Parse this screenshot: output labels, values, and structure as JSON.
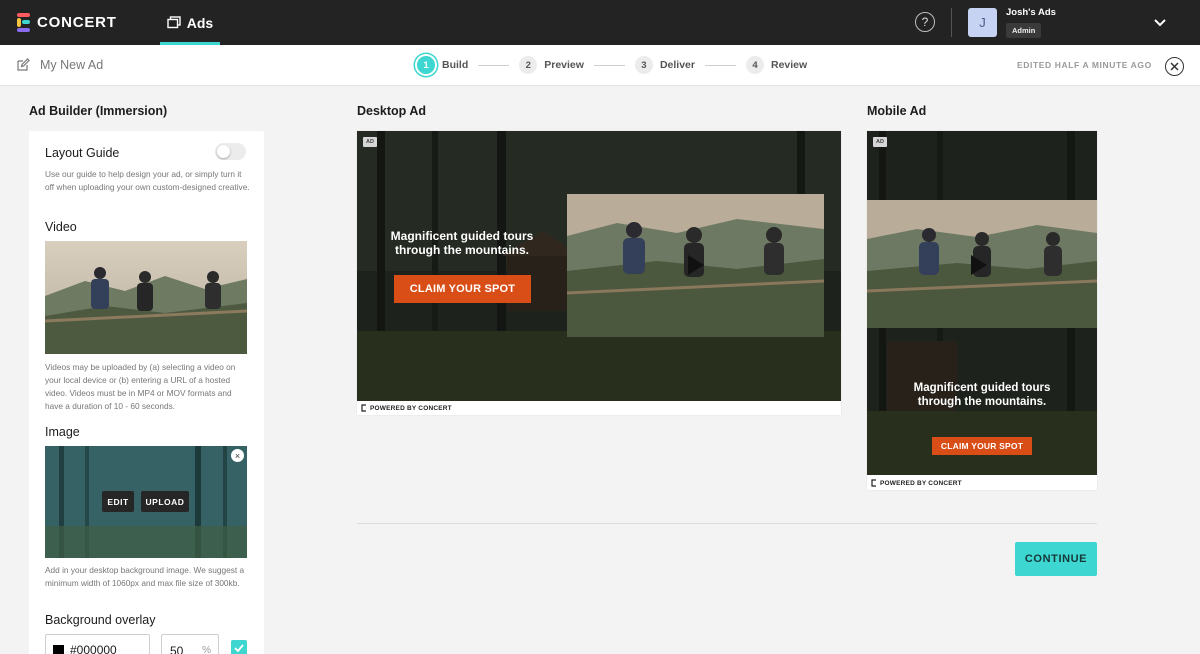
{
  "app": {
    "brand": "CONCERT",
    "nav_tab": "Ads"
  },
  "account": {
    "avatar_initial": "J",
    "name": "Josh's Ads",
    "role": "Admin",
    "help_glyph": "?"
  },
  "subheader": {
    "ad_name": "My New Ad",
    "edited": "EDITED HALF A MINUTE AGO",
    "steps": [
      {
        "num": "1",
        "label": "Build",
        "active": true
      },
      {
        "num": "2",
        "label": "Preview",
        "active": false
      },
      {
        "num": "3",
        "label": "Deliver",
        "active": false
      },
      {
        "num": "4",
        "label": "Review",
        "active": false
      }
    ]
  },
  "builder": {
    "heading": "Ad Builder (Immersion)",
    "layout_guide": {
      "title": "Layout Guide",
      "enabled": false,
      "help": "Use our guide to help design your ad, or simply turn it off when uploading your own custom-designed creative."
    },
    "video": {
      "title": "Video",
      "help": "Videos may be uploaded by (a) selecting a video on your local device or (b) entering a URL of a hosted video. Videos must be in MP4 or MOV formats and have a duration of 10 - 60 seconds."
    },
    "image": {
      "title": "Image",
      "edit_label": "EDIT",
      "upload_label": "UPLOAD",
      "close_glyph": "×",
      "help": "Add in your desktop background image. We suggest a minimum width of 1060px and max file size of 300kb."
    },
    "background_overlay": {
      "title": "Background overlay",
      "color_value": "#000000",
      "opacity_value": "50",
      "opacity_unit": "%",
      "checked": true
    }
  },
  "desktop_ad": {
    "heading": "Desktop Ad",
    "badge": "AD",
    "headline": "Magnificent guided tours through the mountains.",
    "cta": "CLAIM YOUR SPOT",
    "powered_by": "POWERED BY CONCERT"
  },
  "mobile_ad": {
    "heading": "Mobile Ad",
    "badge": "AD",
    "headline": "Magnificent guided tours through the mountains.",
    "cta": "CLAIM YOUR SPOT",
    "powered_by": "POWERED BY CONCERT"
  },
  "footer": {
    "continue_label": "CONTINUE"
  },
  "colors": {
    "accent": "#3dd6d0",
    "cta": "#d94d16",
    "topbar": "#232323"
  },
  "icons": {
    "logo": "concert-logo-icon",
    "nav": "ads-stack-icon",
    "help": "help-icon",
    "chevron": "chevron-down-icon",
    "edit": "pencil-icon",
    "close": "close-icon",
    "check": "check-icon",
    "play": "play-icon"
  }
}
